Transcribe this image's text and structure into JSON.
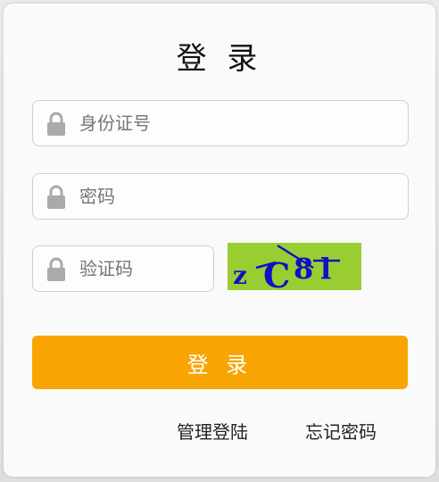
{
  "title": "登 录",
  "fields": {
    "id_number": {
      "placeholder": "身份证号",
      "value": ""
    },
    "password": {
      "placeholder": "密码",
      "value": ""
    },
    "captcha": {
      "placeholder": "验证码",
      "value": ""
    }
  },
  "captcha_image": {
    "text": "zC8l",
    "bg_color": "#9acd32",
    "text_color": "#1010c8"
  },
  "login_button": {
    "label": "登 录",
    "color": "#f8a403"
  },
  "links": {
    "admin_login": "管理登陆",
    "forgot_password": "忘记密码"
  },
  "icons": {
    "field_icon": "lock-icon"
  }
}
